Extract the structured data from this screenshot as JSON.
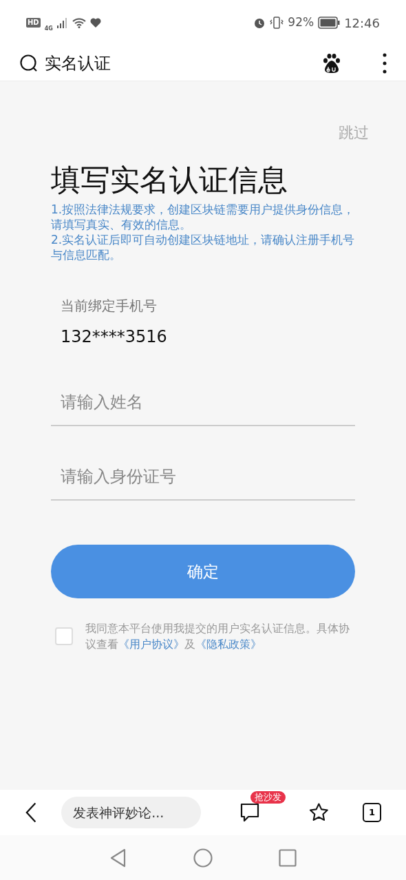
{
  "status_bar": {
    "hd": "HD",
    "network": "4G",
    "battery": "92%",
    "time": "12:46"
  },
  "header": {
    "title": "实名认证"
  },
  "skip": "跳过",
  "title": "填写实名认证信息",
  "notes": [
    "1.按照法律法规要求，创建区块链需要用户提供身份信息，请填写真实、有效的信息。",
    "2.实名认证后即可自动创建区块链地址，请确认注册手机号与信息匹配。"
  ],
  "phone": {
    "label": "当前绑定手机号",
    "value": "132****3516"
  },
  "fields": [
    {
      "placeholder": "请输入姓名"
    },
    {
      "placeholder": "请输入身份证号"
    }
  ],
  "confirm_button": "确定",
  "agreement": {
    "checked": false,
    "text": "我同意本平台使用我提交的用户实名认证信息。具体协议查看",
    "link_1": "《用户协议》",
    "joiner": "及",
    "link_2": "《隐私政策》"
  },
  "bottom_bar": {
    "comment_placeholder": "发表神评妙论...",
    "comment_badge": "抢沙发",
    "tab_count": "1"
  }
}
